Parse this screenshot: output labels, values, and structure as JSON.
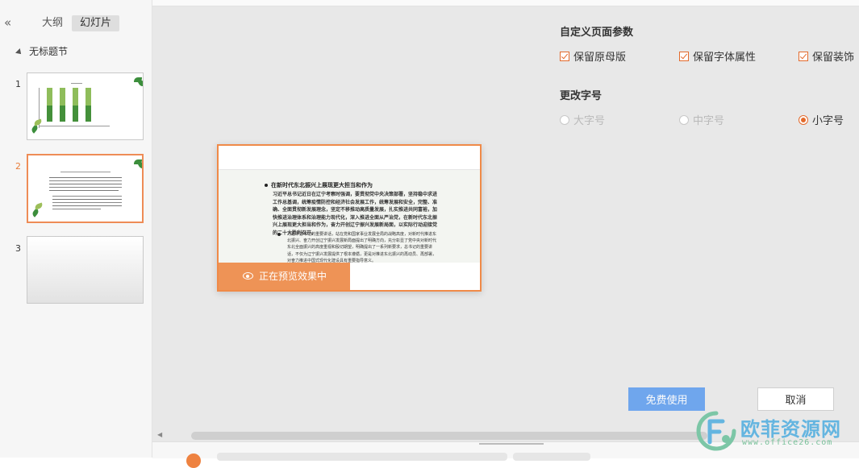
{
  "sidebar": {
    "collapse_icon": "«",
    "tabs": {
      "outline": "大纲",
      "slides": "幻灯片"
    },
    "section_title": "无标题节",
    "slides": [
      {
        "number": "1"
      },
      {
        "number": "2"
      },
      {
        "number": "3"
      }
    ]
  },
  "preview": {
    "title": "在新时代东北振兴上展现更大担当和作为",
    "paragraph": "习近平总书记近日在辽宁考察时强调，要贯彻党中央决策部署，坚持稳中求进工作总基调，统筹疫情防控和经济社会发展工作，统筹发展和安全，完整、准确、全面贯彻新发展理念，坚定不移推动高质量发展，扎实推进共同富裕，加快推进治理体系和治理能力现代化，深入推进全面从严治党，在新时代东北振兴上展现更大担当和作为，奋力开创辽宁振兴发展新局面，以实际行动迎接党的二十大胜利召开。",
    "sub_paragraph": "习近平总书记的重要讲话，站在党和国家事业发展全局的战略高度，对新时代推进东北振兴、奋力开创辽宁振兴发展新局面提出了明确方向，充分彰显了党中央对新时代东北全面振兴的高度重视和殷切期望，明确提出了一系列新要求，总书记的重要讲话，不仅为辽宁振兴发展提供了根本遵循，更是对推进东北振兴的再动员、再部署，对奋力推进中国式现代化建设具有重要指导意义。",
    "status_badge": "正在预览效果中"
  },
  "options": {
    "section1_title": "自定义页面参数",
    "checkboxes": [
      {
        "label": "保留原母版",
        "checked": true
      },
      {
        "label": "保留字体属性",
        "checked": true
      },
      {
        "label": "保留装饰",
        "checked": true
      }
    ],
    "section2_title": "更改字号",
    "radios": [
      {
        "label": "大字号",
        "selected": false,
        "disabled": true
      },
      {
        "label": "中字号",
        "selected": false,
        "disabled": true
      },
      {
        "label": "小字号",
        "selected": true,
        "disabled": false
      }
    ]
  },
  "buttons": {
    "primary": "免费使用",
    "cancel": "取消"
  },
  "watermark": {
    "name": "欧菲资源网",
    "url": "www.office26.com"
  },
  "colors": {
    "accent": "#e36a2c",
    "primary_button": "#5b9bef",
    "preview_border": "#f08a48"
  }
}
